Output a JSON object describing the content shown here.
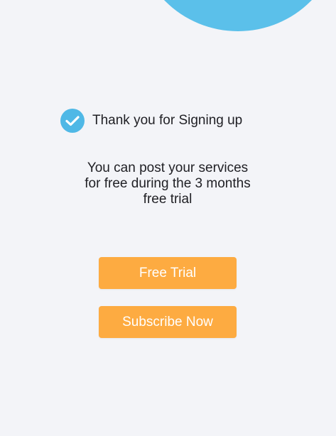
{
  "confirmation": {
    "icon": "check-circle-icon",
    "text": "Thank you for Signing up"
  },
  "message": {
    "lines": [
      "You can post your services",
      "for free during the 3 months",
      "free trial"
    ]
  },
  "buttons": {
    "free_trial_label": "Free Trial",
    "subscribe_label": "Subscribe Now"
  },
  "colors": {
    "accent_blue": "#5bc0ea",
    "button_orange": "#fdab41",
    "background": "#f3f4f8"
  }
}
